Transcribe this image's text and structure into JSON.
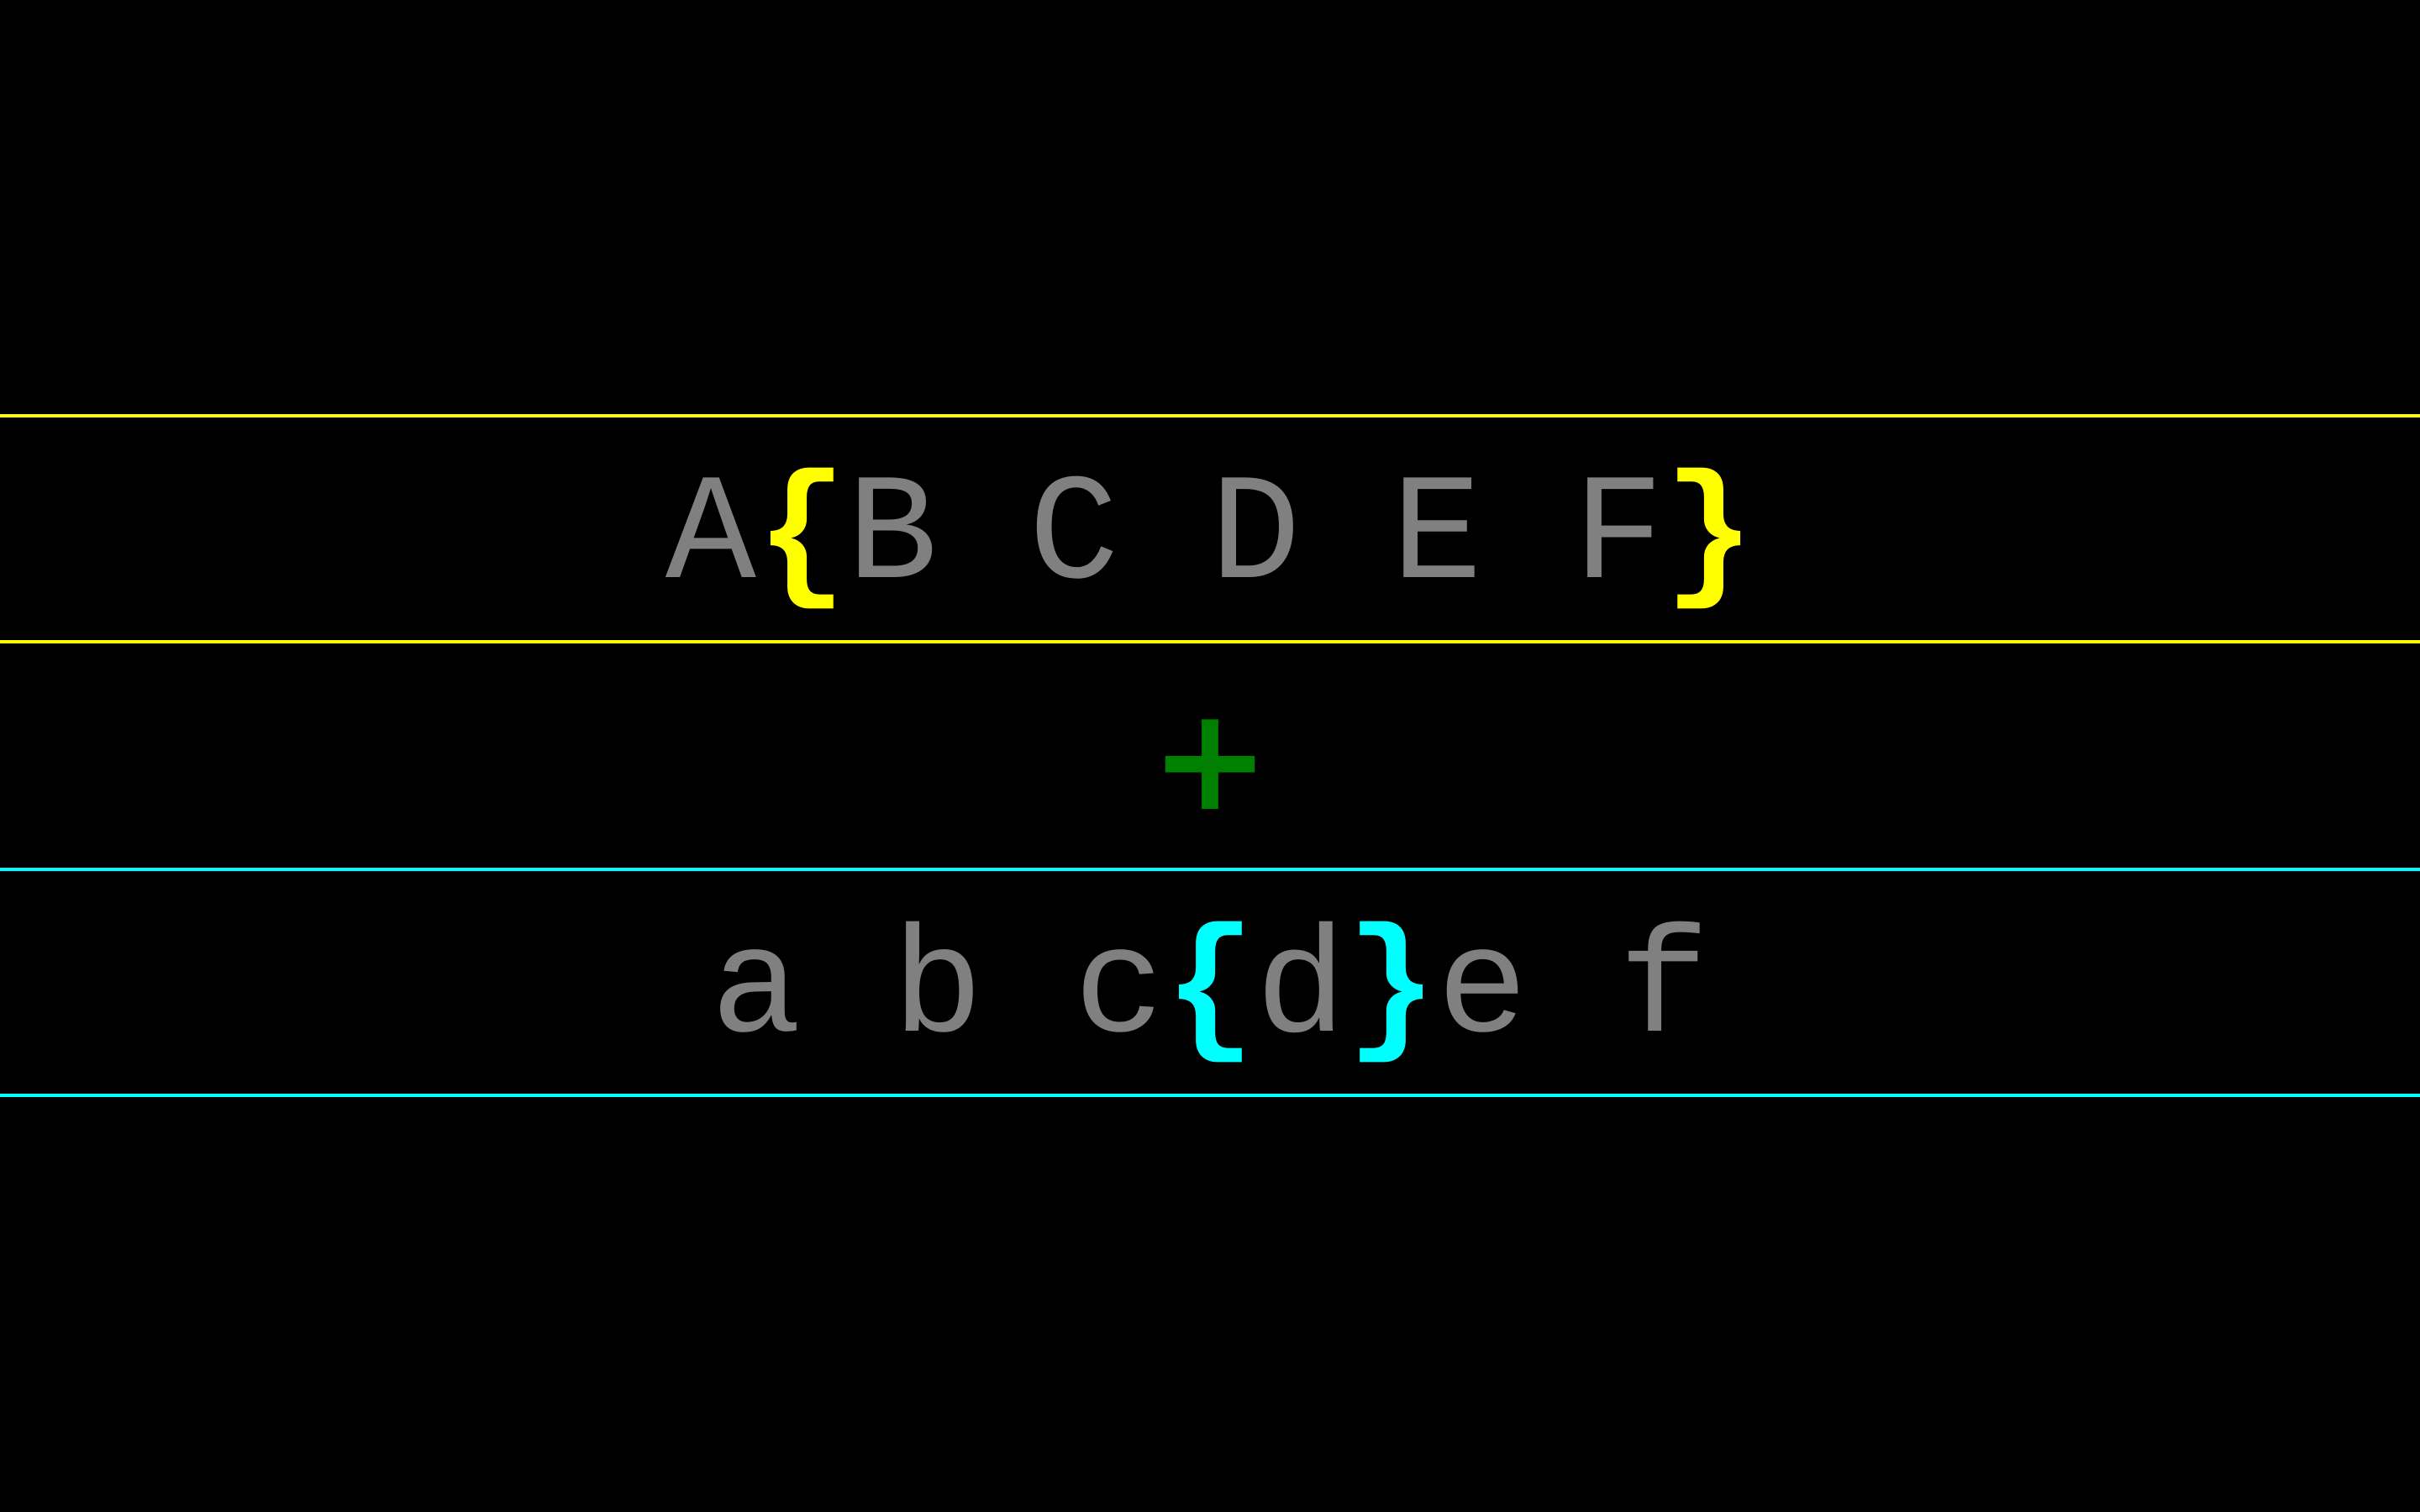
{
  "colors": {
    "background": "#000000",
    "letters": "#808080",
    "top_bracket": "#ffff00",
    "bottom_bracket": "#00ffff",
    "fixation": "#008000"
  },
  "top_row": {
    "segments": [
      {
        "text": "A",
        "style": "plain"
      },
      {
        "text": "{",
        "style": "bracket-yellow"
      },
      {
        "text": "B C D E F",
        "style": "plain"
      },
      {
        "text": "}",
        "style": "bracket-yellow"
      }
    ]
  },
  "fixation": {
    "symbol": "+",
    "icon": "plus-icon"
  },
  "bottom_row": {
    "segments": [
      {
        "text": "a b c",
        "style": "plain"
      },
      {
        "text": "{",
        "style": "bracket-cyan"
      },
      {
        "text": "d",
        "style": "plain"
      },
      {
        "text": "}",
        "style": "bracket-cyan"
      },
      {
        "text": "e f",
        "style": "plain"
      }
    ]
  }
}
